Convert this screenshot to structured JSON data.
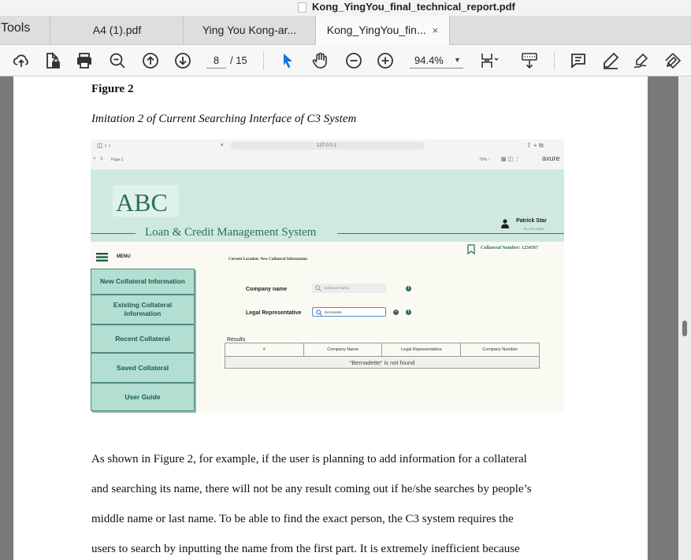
{
  "window": {
    "title": "Kong_YingYou_final_technical_report.pdf"
  },
  "tabs": {
    "tools_label": "Tools",
    "items": [
      {
        "label": "A4 (1).pdf"
      },
      {
        "label": "Ying You Kong-ar..."
      },
      {
        "label": "Kong_YingYou_fin...",
        "close": "×"
      }
    ]
  },
  "toolbar": {
    "current_page": "8",
    "total_pages": "/ 15",
    "zoom": "94.4%",
    "icons": [
      "cloud-upload-icon",
      "file-lock-icon",
      "print-icon",
      "zoom-search-icon",
      "page-up-icon",
      "page-down-icon",
      "select-arrow-icon",
      "hand-icon",
      "zoom-out-icon",
      "zoom-in-icon",
      "fit-page-icon",
      "keyboard-scroll-icon",
      "comment-icon",
      "highlight-pen-icon",
      "sign-icon",
      "share-edit-icon"
    ]
  },
  "document": {
    "figure_label": "Figure 2",
    "figure_caption": "Imitation 2 of Current Searching Interface of C3 System",
    "paragraph_lines": [
      "As shown in Figure 2, for example, if the user is planning to add information for a collateral",
      "and searching its name, there will not be any result coming out if he/she searches by people’s",
      "middle name or last name. To be able to find the exact person, the C3 system requires the",
      "users to search by inputting the name from the first part. It is extremely inefficient because"
    ]
  },
  "figure_app": {
    "browser_url": "127.0.0.1",
    "browser_page": "Page 1",
    "browser_zoom": "79% ~",
    "browser_brand": "axure",
    "logo": "ABC",
    "system_title": "Loan & Credit Management System",
    "user_name": "Patrick Star",
    "user_sub": "ID: PSC34567",
    "collateral_number": "Collateral Number: 1234567",
    "menu_label": "MENU",
    "current_location": "Current Location: New Collateral Information",
    "side_menu": [
      "New Collateral Information",
      "Existing Collateral Information",
      "Recent Collateral",
      "Saved Collateral",
      "User Guide"
    ],
    "company_label": "Company name",
    "company_placeholder": "Goldman Sachs",
    "legal_label": "Legal Representative",
    "legal_value": "Bernadette",
    "results_label": "Results",
    "table_headers": [
      "#",
      "Company Name",
      "Legal Representative",
      "Company Number"
    ],
    "not_found": "“Bernadette” is not found"
  },
  "colors": {
    "header_mint": "#cfe9df",
    "menu_teal": "#b3ded2",
    "brand_green": "#2e6e5e",
    "select_arrow_blue": "#1473e6"
  }
}
